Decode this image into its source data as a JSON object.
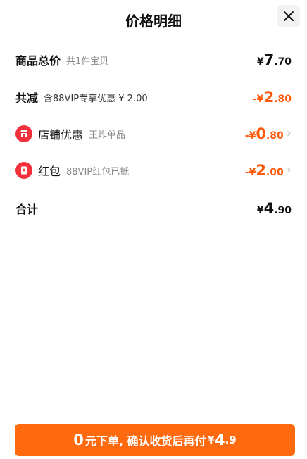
{
  "header": {
    "title": "价格明细"
  },
  "rows": {
    "goods": {
      "label": "商品总价",
      "sub": "共1件宝贝",
      "yen": "¥",
      "int": "7",
      "dec": ".70"
    },
    "reduce": {
      "label": "共减",
      "sub": "含88VIP专享优惠 ¥ 2.00",
      "prefix": "-¥",
      "int": "2",
      "dec": ".80"
    },
    "shop": {
      "label": "店铺优惠",
      "sub": "王炸单品",
      "prefix": "-¥",
      "int": "0",
      "dec": ".80",
      "icon": "shop-icon"
    },
    "redpacket": {
      "label": "红包",
      "sub": "88VIP红包已抵",
      "prefix": "-¥",
      "int": "2",
      "dec": ".00",
      "icon": "red-packet-icon"
    },
    "total": {
      "label": "合计",
      "yen": "¥",
      "int": "4",
      "dec": ".90"
    }
  },
  "cta": {
    "zero": "0",
    "text": "元下单, 确认收货后再付",
    "yen": "¥",
    "int": "4",
    "dec": ".9"
  },
  "colors": {
    "accent": "#ff5a0a",
    "button": "#ff6a0f",
    "badge": "#f4303a"
  }
}
